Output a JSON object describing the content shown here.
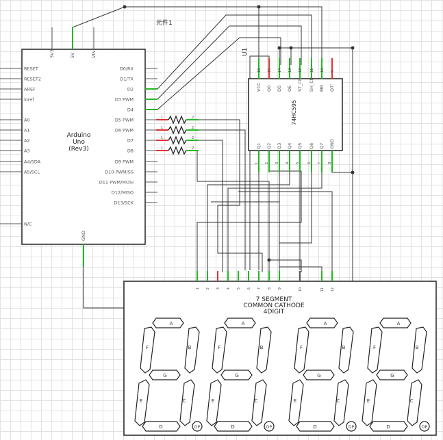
{
  "component_label": "元件1",
  "arduino": {
    "title_lines": [
      "Arduino",
      "Uno",
      "(Rev3)"
    ],
    "top_pins": [
      "3V3",
      "5V",
      "VIN"
    ],
    "left_pins": [
      "RESET",
      "RESET2",
      "AREF",
      "ioref",
      "A0",
      "A1",
      "A2",
      "A3",
      "A4/SDA",
      "A5/SCL",
      "N/C"
    ],
    "right_pins": [
      "D0/RX",
      "D1/TX",
      "D2",
      "D3 PWM",
      "D4",
      "D5 PWM",
      "D6 PWM",
      "D7",
      "D8",
      "D9 PWM",
      "D10 PWM/SS",
      "D11 PWM/MOSI",
      "D12/MISO",
      "D13/SCK"
    ],
    "bottom_pin": "GND"
  },
  "shift_register": {
    "ref": "U1",
    "part": "74HC595",
    "top_pins": [
      {
        "num": "16",
        "name": "VCC"
      },
      {
        "num": "15",
        "name": "Q0"
      },
      {
        "num": "14",
        "name": "DS"
      },
      {
        "num": "13",
        "name": "OE"
      },
      {
        "num": "12",
        "name": "ST_CP"
      },
      {
        "num": "11",
        "name": "SH_CP"
      },
      {
        "num": "10",
        "name": "MR"
      },
      {
        "num": "9",
        "name": "Q7'"
      }
    ],
    "bottom_pins": [
      {
        "num": "1",
        "name": "Q1"
      },
      {
        "num": "2",
        "name": "Q2"
      },
      {
        "num": "3",
        "name": "Q3"
      },
      {
        "num": "4",
        "name": "Q4"
      },
      {
        "num": "5",
        "name": "Q5"
      },
      {
        "num": "6",
        "name": "Q6"
      },
      {
        "num": "7",
        "name": "Q7"
      },
      {
        "num": "8",
        "name": "GND"
      }
    ]
  },
  "resistors": [
    {
      "pin1": "1",
      "pin2": "2"
    },
    {
      "pin1": "1",
      "pin2": "2"
    },
    {
      "pin1": "1",
      "pin2": "2"
    },
    {
      "pin1": "1",
      "pin2": "2"
    }
  ],
  "display": {
    "title_lines": [
      "7 SEGMENT",
      "COMMON CATHODE",
      "4DIGIT"
    ],
    "pins": [
      "1",
      "2",
      "3",
      "4",
      "5",
      "6",
      "7",
      "8",
      "9",
      "10",
      "11",
      "12"
    ],
    "segments": [
      "A",
      "B",
      "C",
      "D",
      "E",
      "F",
      "G"
    ],
    "dp_label": "DP",
    "digit_count": 4
  }
}
